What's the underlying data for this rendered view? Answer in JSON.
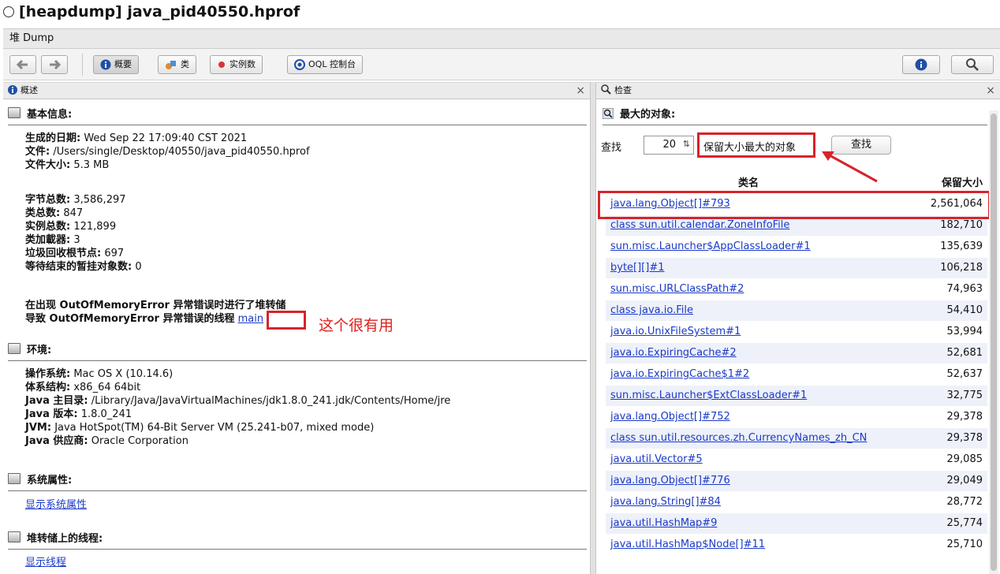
{
  "window": {
    "title": "[heapdump] java_pid40550.hprof"
  },
  "tab": {
    "label": "堆 Dump"
  },
  "toolbar": {
    "overview": "概要",
    "classes": "类",
    "instances": "实例数",
    "oql": "OQL 控制台"
  },
  "left_pane": {
    "title": "概述",
    "basic": {
      "heading": "基本信息:",
      "date_label": "生成的日期:",
      "date": "Wed Sep 22 17:09:40 CST 2021",
      "file_label": "文件:",
      "file": "/Users/single/Desktop/40550/java_pid40550.hprof",
      "size_label": "文件大小:",
      "size": "5.3 MB",
      "bytes_label": "字节总数:",
      "bytes": "3,586,297",
      "classes_label": "类总数:",
      "classes": "847",
      "instances_label": "实例总数:",
      "instances": "121,899",
      "loaders_label": "类加載器:",
      "loaders": "3",
      "gcroots_label": "垃圾回收根节点:",
      "gcroots": "697",
      "pending_label": "等待结束的暂挂对象数:",
      "pending": "0",
      "oom_line": "在出现 OutOfMemoryError 异常错误时进行了堆转储",
      "oom_thread_label": "导致 OutOfMemoryError 异常错误的线程",
      "oom_thread": "main",
      "annotation": "这个很有用"
    },
    "env": {
      "heading": "环境:",
      "os_label": "操作系统:",
      "os": "Mac OS X (10.14.6)",
      "arch_label": "体系结构:",
      "arch": "x86_64 64bit",
      "home_label": "Java 主目录:",
      "home": "/Library/Java/JavaVirtualMachines/jdk1.8.0_241.jdk/Contents/Home/jre",
      "ver_label": "Java 版本:",
      "ver": "1.8.0_241",
      "jvm_label": "JVM:",
      "jvm": "Java HotSpot(TM) 64-Bit Server VM (25.241-b07, mixed mode)",
      "vendor_label": "Java 供应商:",
      "vendor": "Oracle Corporation"
    },
    "sysprops": {
      "heading": "系统属性:",
      "link": "显示系统属性"
    },
    "threads": {
      "heading": "堆转储上的线程:",
      "link": "显示线程"
    }
  },
  "right_pane": {
    "title": "检查",
    "heading": "最大的对象:",
    "find_label": "查找",
    "count": "20",
    "mode": "保留大小最大的对象",
    "find_button": "查找",
    "col_name": "类名",
    "col_size": "保留大小",
    "rows": [
      {
        "name": "java.lang.Object[]#793",
        "size": "2,561,064"
      },
      {
        "name": "class sun.util.calendar.ZoneInfoFile",
        "size": "182,710"
      },
      {
        "name": "sun.misc.Launcher$AppClassLoader#1",
        "size": "135,639"
      },
      {
        "name": "byte[][]#1",
        "size": "106,218"
      },
      {
        "name": "sun.misc.URLClassPath#2",
        "size": "74,963"
      },
      {
        "name": "class java.io.File",
        "size": "54,410"
      },
      {
        "name": "java.io.UnixFileSystem#1",
        "size": "53,994"
      },
      {
        "name": "java.io.ExpiringCache#2",
        "size": "52,681"
      },
      {
        "name": "java.io.ExpiringCache$1#2",
        "size": "52,637"
      },
      {
        "name": "sun.misc.Launcher$ExtClassLoader#1",
        "size": "32,775"
      },
      {
        "name": "java.lang.Object[]#752",
        "size": "29,378"
      },
      {
        "name": "class sun.util.resources.zh.CurrencyNames_zh_CN",
        "size": "29,378"
      },
      {
        "name": "java.util.Vector#5",
        "size": "29,085"
      },
      {
        "name": "java.lang.Object[]#776",
        "size": "29,049"
      },
      {
        "name": "java.lang.String[]#84",
        "size": "28,772"
      },
      {
        "name": "java.util.HashMap#9",
        "size": "25,774"
      },
      {
        "name": "java.util.HashMap$Node[]#11",
        "size": "25,710"
      }
    ]
  }
}
